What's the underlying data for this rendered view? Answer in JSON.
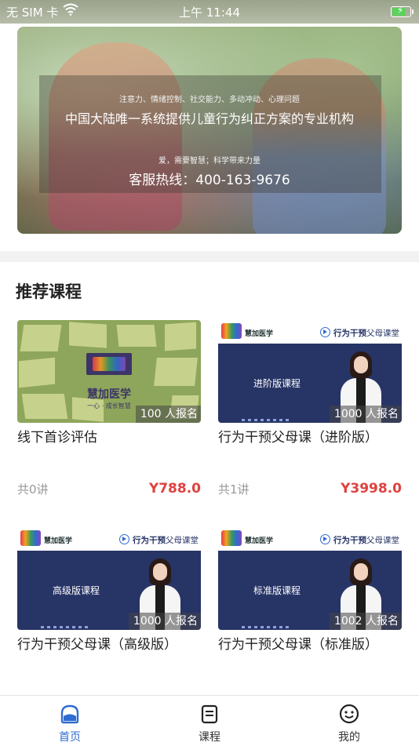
{
  "status_bar": {
    "carrier": "无 SIM 卡",
    "time": "上午 11:44",
    "battery_level": 0.72
  },
  "banner": {
    "tags": "注意力、情绪控制、社交能力、多动冲动、心理问题",
    "headline": "中国大陆唯一系统提供儿童行为纠正方案的专业机构",
    "slogan": "爱，需要智慧；科学带来力量",
    "hotline": "客服热线：400-163-9676"
  },
  "section": {
    "title": "推荐课程"
  },
  "courses": [
    {
      "title": "线下首诊评估",
      "enrolled": "100 人报名",
      "lectures": "共0讲",
      "price": "Y788.0",
      "thumb": {
        "style": "green",
        "brand": "慧加医学",
        "slogan": "一心 · 成长智慧"
      }
    },
    {
      "title": "行为干预父母课（进阶版）",
      "enrolled": "1000 人报名",
      "lectures": "共1讲",
      "price": "Y3998.0",
      "thumb": {
        "style": "navy",
        "brand": "慧加医学",
        "series_bold": "行为干预",
        "series_rest": "父母课堂",
        "level": "进阶版课程"
      }
    },
    {
      "title": "行为干预父母课（高级版）",
      "enrolled": "1000 人报名",
      "lectures": "",
      "price": "",
      "thumb": {
        "style": "navy",
        "brand": "慧加医学",
        "series_bold": "行为干预",
        "series_rest": "父母课堂",
        "level": "高级版课程"
      }
    },
    {
      "title": "行为干预父母课（标准版）",
      "enrolled": "1002 人报名",
      "lectures": "",
      "price": "",
      "thumb": {
        "style": "navy",
        "brand": "慧加医学",
        "series_bold": "行为干预",
        "series_rest": "父母课堂",
        "level": "标准版课程"
      }
    }
  ],
  "tab_bar": {
    "tabs": [
      {
        "label": "首页",
        "icon": "home-icon",
        "active": true
      },
      {
        "label": "课程",
        "icon": "course-icon",
        "active": false
      },
      {
        "label": "我的",
        "icon": "smiley-profile-icon",
        "active": false
      }
    ],
    "active_color": "#2f6bd0"
  },
  "colors": {
    "price": "#e0413e",
    "thumb_navy": "#273466",
    "thumb_green": "#8ea65b"
  }
}
